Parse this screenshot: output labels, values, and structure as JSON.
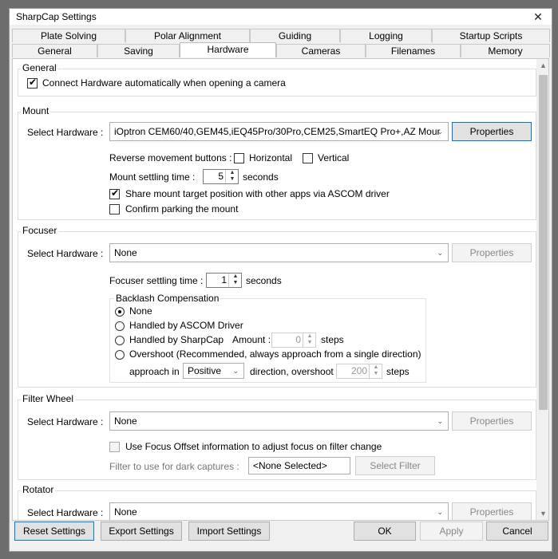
{
  "window": {
    "title": "SharpCap Settings",
    "close_glyph": "✕"
  },
  "tabs_row1": [
    {
      "label": "Plate Solving"
    },
    {
      "label": "Polar Alignment"
    },
    {
      "label": "Guiding"
    },
    {
      "label": "Logging"
    },
    {
      "label": "Startup Scripts"
    }
  ],
  "tabs_row2": [
    {
      "label": "General"
    },
    {
      "label": "Saving"
    },
    {
      "label": "Hardware",
      "active": true
    },
    {
      "label": "Cameras"
    },
    {
      "label": "Filenames"
    },
    {
      "label": "Memory"
    }
  ],
  "general": {
    "title": "General",
    "connect_label": "Connect Hardware automatically when opening a camera",
    "connect_checked": true
  },
  "mount": {
    "title": "Mount",
    "select_label": "Select Hardware :",
    "hardware": "iOptron CEM60/40,GEM45,iEQ45Pro/30Pro,CEM25,SmartEQ Pro+,AZ Mour",
    "properties": "Properties",
    "reverse_label": "Reverse movement buttons :",
    "horizontal_label": "Horizontal",
    "vertical_label": "Vertical",
    "settling_label": "Mount settling time :",
    "settling_value": "5",
    "seconds_label": "seconds",
    "share_label": "Share mount target position with other apps via ASCOM driver",
    "share_checked": true,
    "confirm_label": "Confirm parking the mount"
  },
  "focuser": {
    "title": "Focuser",
    "select_label": "Select Hardware :",
    "hardware": "None",
    "properties": "Properties",
    "settling_label": "Focuser settling time :",
    "settling_value": "1",
    "seconds_label": "seconds",
    "backlash_title": "Backlash Compensation",
    "opt_none": "None",
    "opt_ascom": "Handled by ASCOM Driver",
    "opt_sharpcap": "Handled by SharpCap",
    "amount_label": "Amount :",
    "amount_value": "0",
    "steps_label": "steps",
    "opt_overshoot": "Overshoot (Recommended, always approach from a single direction)",
    "approach_label": "approach in",
    "approach_value": "Positive",
    "overshoot_label": "direction, overshoot",
    "overshoot_value": "200",
    "steps_label2": "steps"
  },
  "filter_wheel": {
    "title": "Filter Wheel",
    "select_label": "Select Hardware :",
    "hardware": "None",
    "properties": "Properties",
    "focus_offset_label": "Use Focus Offset information to adjust focus on filter change",
    "dark_label": "Filter to use for dark captures :",
    "dark_value": "<None Selected>",
    "select_filter": "Select Filter"
  },
  "rotator": {
    "title": "Rotator",
    "select_label": "Select Hardware :",
    "hardware": "None",
    "properties": "Properties"
  },
  "footer": {
    "reset": "Reset Settings",
    "export": "Export Settings",
    "import": "Import Settings",
    "ok": "OK",
    "apply": "Apply",
    "cancel": "Cancel"
  },
  "icons": {
    "check": "✔",
    "dropdown": "⌄",
    "close": "close-icon"
  }
}
